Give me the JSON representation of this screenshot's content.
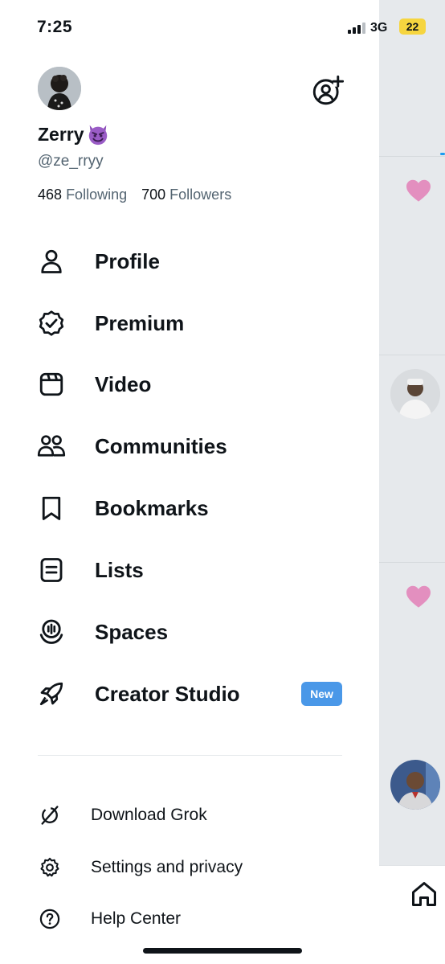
{
  "status_bar": {
    "time": "7:25",
    "network": "3G",
    "battery": "22"
  },
  "profile": {
    "name": "Zerry",
    "handle": "@ze_rryy",
    "following_count": "468",
    "following_label": "Following",
    "followers_count": "700",
    "followers_label": "Followers"
  },
  "menu": [
    {
      "label": "Profile",
      "icon": "person-icon"
    },
    {
      "label": "Premium",
      "icon": "verified-badge-icon"
    },
    {
      "label": "Video",
      "icon": "video-icon"
    },
    {
      "label": "Communities",
      "icon": "communities-icon"
    },
    {
      "label": "Bookmarks",
      "icon": "bookmark-icon"
    },
    {
      "label": "Lists",
      "icon": "list-icon"
    },
    {
      "label": "Spaces",
      "icon": "spaces-icon"
    },
    {
      "label": "Creator Studio",
      "icon": "rocket-icon",
      "badge": "New"
    }
  ],
  "secondary_menu": [
    {
      "label": "Download Grok",
      "icon": "grok-icon"
    },
    {
      "label": "Settings and privacy",
      "icon": "gear-icon"
    },
    {
      "label": "Help Center",
      "icon": "help-icon"
    }
  ],
  "colors": {
    "text": "#0f1419",
    "secondary_text": "#536471",
    "badge": "#4a98e8",
    "heart": "#e38fbf",
    "battery": "#f6d53f",
    "backdrop": "#e6e9ec"
  }
}
